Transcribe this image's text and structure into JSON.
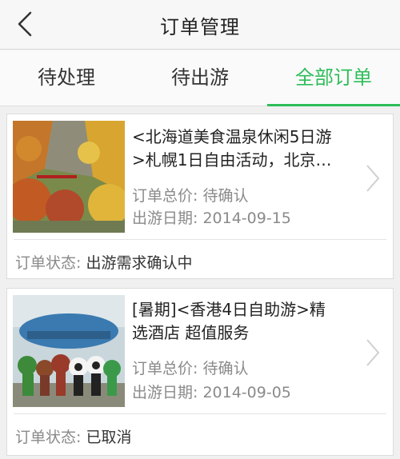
{
  "header": {
    "title": "订单管理",
    "back_icon": "chevron-left-icon"
  },
  "tabs": [
    {
      "label": "待处理",
      "active": false
    },
    {
      "label": "待出游",
      "active": false
    },
    {
      "label": "全部订单",
      "active": true
    }
  ],
  "colors": {
    "accent": "#2ebd59",
    "muted": "#8a8a8a",
    "text": "#333333"
  },
  "orders": [
    {
      "title_line1": "<北海道美食温泉休闲5日游",
      "title_line2": ">札幌1日自由活动，北京…",
      "price_label": "订单总价: ",
      "price_value": "待确认",
      "date_label": "出游日期: ",
      "date_value": "2014-09-15",
      "status_label": "订单状态: ",
      "status_value": "出游需求确认中",
      "thumbnail": "autumn-gorge-photo"
    },
    {
      "title_line1": "[暑期]<香港4日自助游>精",
      "title_line2": "选酒店 超值服务",
      "price_label": "订单总价: ",
      "price_value": "待确认",
      "date_label": "出游日期: ",
      "date_value": "2014-09-05",
      "status_label": "订单状态: ",
      "status_value": "已取消",
      "thumbnail": "theme-park-mascots-photo"
    }
  ]
}
